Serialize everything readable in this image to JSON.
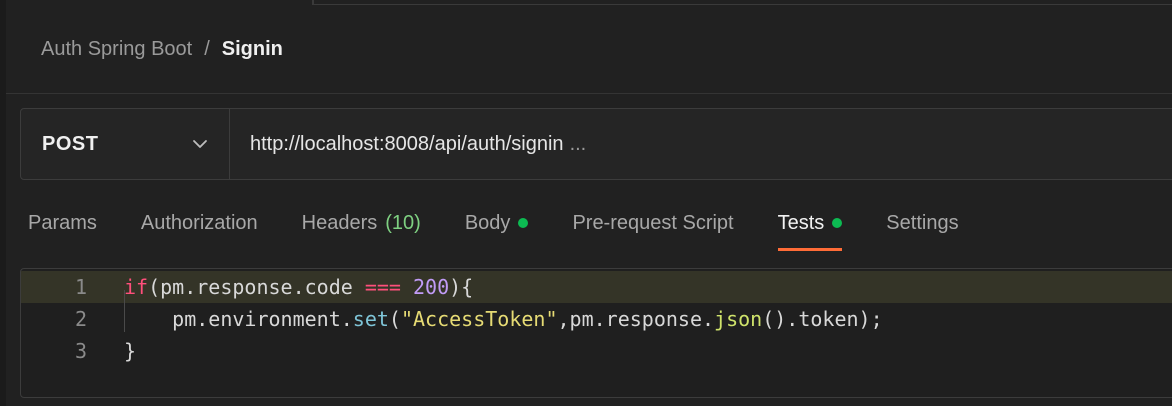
{
  "breadcrumb": {
    "parent": "Auth Spring Boot",
    "separator": "/",
    "current": "Signin"
  },
  "request": {
    "method": "POST",
    "url": "http://localhost:8008/api/auth/signin",
    "url_ellipsis": "..."
  },
  "tabs": [
    {
      "label": "Params"
    },
    {
      "label": "Authorization"
    },
    {
      "label": "Headers",
      "count": "(10)"
    },
    {
      "label": "Body",
      "indicator": "green-dot"
    },
    {
      "label": "Pre-request Script"
    },
    {
      "label": "Tests",
      "indicator": "green-dot",
      "active": true
    },
    {
      "label": "Settings"
    }
  ],
  "editor": {
    "line_numbers": [
      "1",
      "2",
      "3"
    ],
    "tokens": {
      "l1_if": "if",
      "l1_open": "(pm.response.code ",
      "l1_eq": "===",
      "l1_num": "200",
      "l1_close": "){",
      "l2_obj": "    pm.environment.",
      "l2_set": "set",
      "l2_open": "(",
      "l2_str": "\"AccessToken\"",
      "l2_mid": ",pm.response.",
      "l2_json": "json",
      "l2_end": "().token);",
      "l3_brace": "}"
    }
  },
  "colors": {
    "accent_tab": "#ff6c37",
    "indicator_green": "#0cbb52",
    "count_green": "#7ed081"
  },
  "icons": {
    "method_dropdown": "chevron-down-icon"
  }
}
